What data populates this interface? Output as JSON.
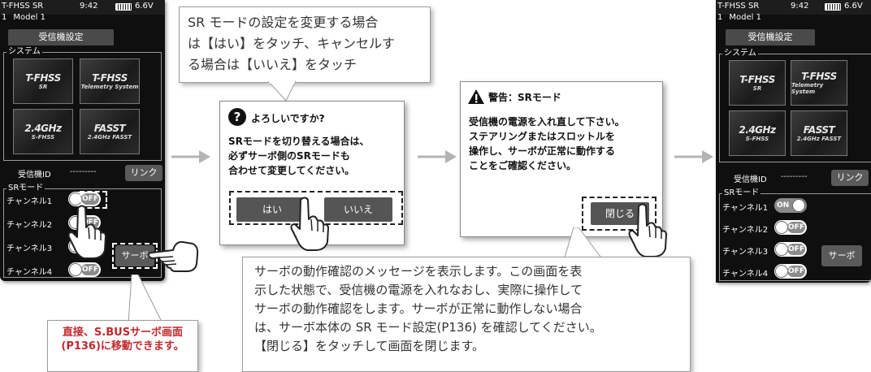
{
  "screens": {
    "left": {
      "status": "T-FHSS SR",
      "time": "9:42",
      "voltage": "6.6V",
      "model_num": "1",
      "model_name": "Model 1",
      "title": "受信機設定",
      "system_label": "システム",
      "tiles": [
        {
          "logo": "T-FHSS",
          "sub": "SR"
        },
        {
          "logo": "T-FHSS",
          "sub": "Telemetry System"
        },
        {
          "logo": "2.4GHz",
          "sub": "S-FHSS"
        },
        {
          "logo": "FASST",
          "sub": "2.4GHz FASST"
        }
      ],
      "rx_id_label": "受信機ID",
      "rx_id_value": "---------",
      "link_label": "リンク",
      "sr_label": "SRモード",
      "channels": [
        {
          "label": "チャンネル1",
          "state": "OFF"
        },
        {
          "label": "チャンネル2",
          "state": "OFF"
        },
        {
          "label": "チャンネル3",
          "state": "OFF"
        },
        {
          "label": "チャンネル4",
          "state": "OFF"
        }
      ],
      "servo_label": "サーボ"
    },
    "right": {
      "status": "T-FHSS SR",
      "time": "9:42",
      "voltage": "6.6V",
      "model_num": "1",
      "model_name": "Model 1",
      "title": "受信機設定",
      "system_label": "システム",
      "tiles": [
        {
          "logo": "T-FHSS",
          "sub": "SR"
        },
        {
          "logo": "T-FHSS",
          "sub": "Telemetry System"
        },
        {
          "logo": "2.4GHz",
          "sub": "S-FHSS"
        },
        {
          "logo": "FASST",
          "sub": "2.4GHz FASST"
        }
      ],
      "rx_id_label": "受信機ID",
      "rx_id_value": "---------",
      "link_label": "リンク",
      "sr_label": "SRモード",
      "channels": [
        {
          "label": "チャンネル1",
          "state": "ON"
        },
        {
          "label": "チャンネル2",
          "state": "OFF"
        },
        {
          "label": "チャンネル3",
          "state": "OFF"
        },
        {
          "label": "チャンネル4",
          "state": "OFF"
        }
      ],
      "servo_label": "サーボ"
    }
  },
  "callout_top": {
    "lines": [
      "SR モードの設定を変更する場合",
      "は【はい】をタッチ、キャンセルす",
      "る場合は【いいえ】をタッチ"
    ]
  },
  "confirm_dialog": {
    "title": "よろしいですか?",
    "message": "SRモードを切り替える場合は、\n必ずサーボ側のSRモードも\n合わせて変更してください。",
    "yes_label": "はい",
    "no_label": "いいえ"
  },
  "warning_dialog": {
    "title": "警告：SRモード",
    "message": "受信機の電源を入れ直して下さい。\nステアリングまたはスロットルを\n操作し、サーボが正常に動作する\nことをご確認ください。",
    "close_label": "閉じる"
  },
  "note_left": {
    "text": "直接、S.BUSサーボ画面\n(P136)に移動できます。"
  },
  "description": {
    "text": "サーボの動作確認のメッセージを表示します。この画面を表\n示した状態で、受信機の電源を入れなおし、実際に操作して\nサーボの動作確認をします。サーボが正常に動作しない場合\nは、サーボ本体の SR モード設定(P136) を確認してください。\n【閉じる】をタッチして画面を閉じます。"
  },
  "colors": {
    "screen_bg": "#0f0f0f",
    "accent_red": "#c0282d",
    "button_gray": "#555555",
    "arrow_gray": "#b4b4b4"
  }
}
